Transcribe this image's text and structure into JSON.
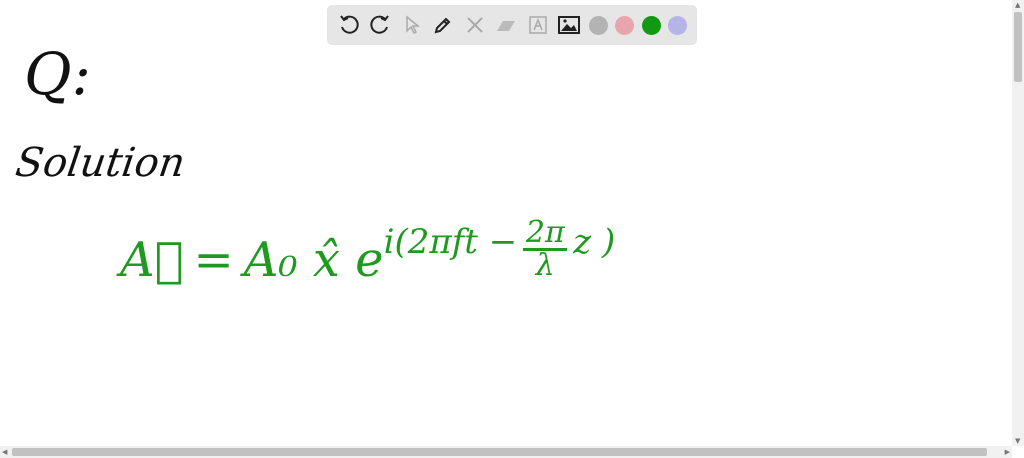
{
  "toolbar": {
    "tools": [
      {
        "name": "undo-icon",
        "enabled": true
      },
      {
        "name": "redo-icon",
        "enabled": true
      },
      {
        "name": "pointer-icon",
        "enabled": false
      },
      {
        "name": "pen-icon",
        "enabled": true
      },
      {
        "name": "tools-icon",
        "enabled": false
      },
      {
        "name": "eraser-icon",
        "enabled": false
      },
      {
        "name": "text-icon",
        "enabled": false
      },
      {
        "name": "image-icon",
        "enabled": true
      }
    ],
    "colors": [
      "#b3b3b3",
      "#e8a5ad",
      "#119911",
      "#b6b3e8"
    ],
    "selected_color": "#119911"
  },
  "canvas": {
    "question_label": "Q:",
    "solution_label": "Solution",
    "equation": {
      "lhs": "A⃗",
      "equals": "=",
      "amplitude": "A₀ x̂ e",
      "exponent_start": "i(2πft −",
      "frac_num": "2π",
      "frac_den": "λ",
      "exponent_end": "z )"
    }
  }
}
